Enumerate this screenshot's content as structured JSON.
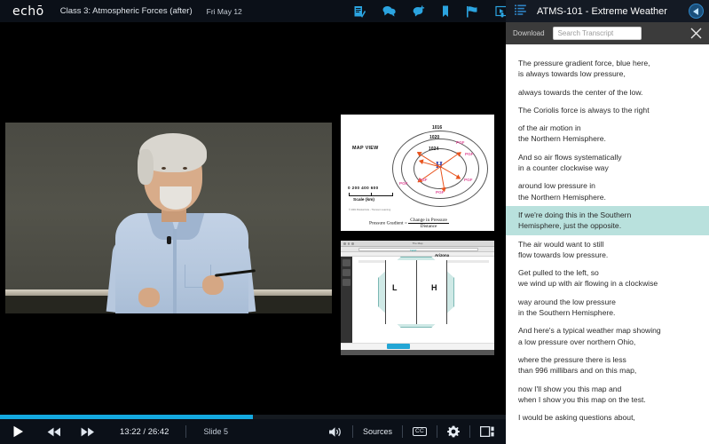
{
  "topbar": {
    "logo": "echō",
    "class_title": "Class 3: Atmospheric Forces (after)",
    "date": "Fri May 12",
    "icons": [
      {
        "name": "notes-icon"
      },
      {
        "name": "discussion-icon"
      },
      {
        "name": "add-comment-icon"
      },
      {
        "name": "bookmark-icon"
      },
      {
        "name": "flag-icon"
      },
      {
        "name": "slide-video-icon"
      }
    ]
  },
  "transcript": {
    "title": "ATMS-101 - Extreme Weather",
    "list_icon": "list-icon",
    "back_icon": "back-arrow-icon",
    "download_label": "Download",
    "search_placeholder": "Search Transcript",
    "search_value": "",
    "close_icon": "close-icon",
    "highlight_color": "#b9e1dd",
    "paragraphs": [
      {
        "text": "The pressure gradient force, blue here,\nis always towards low pressure,",
        "highlighted": false
      },
      {
        "text": "always towards the center of the low.",
        "highlighted": false
      },
      {
        "text": "The Coriolis force is always to the right",
        "highlighted": false
      },
      {
        "text": "of the air motion in\nthe Northern Hemisphere.",
        "highlighted": false
      },
      {
        "text": "And so air flows systematically\nin a counter clockwise way",
        "highlighted": false
      },
      {
        "text": "around low pressure in\nthe Northern Hemisphere.",
        "highlighted": false
      },
      {
        "text": "If we're doing this in the Southern\nHemisphere, just the opposite.",
        "highlighted": true
      },
      {
        "text": "The air would want to still\nflow towards low pressure.",
        "highlighted": false
      },
      {
        "text": "Get pulled to the left, so\nwe wind up with air flowing in a clockwise",
        "highlighted": false
      },
      {
        "text": "way around the low pressure\nin the Southern Hemisphere.",
        "highlighted": false
      },
      {
        "text": "And here's a typical weather map showing\na low pressure over northern Ohio,",
        "highlighted": false
      },
      {
        "text": "where the pressure there is less\nthan 996 millibars and on this map,",
        "highlighted": false
      },
      {
        "text": "now I'll show you this map and\nwhen I show you this map on the test.",
        "highlighted": false
      },
      {
        "text": "I would be asking questions about,",
        "highlighted": false
      }
    ]
  },
  "slides": {
    "slide1": {
      "map_view_label": "MAP VIEW",
      "isobars": [
        "1016",
        "1020",
        "1024"
      ],
      "center_letter": "H",
      "pgf_labels": [
        "PGF",
        "PGF",
        "PGF",
        "PGF",
        "PGF",
        "PGF"
      ],
      "scale_numbers": "0   200  400  600",
      "scale_label": "Scale (km)",
      "credit": "© 2001 Brooks/Cole - Thomson Learning",
      "formula_lhs": "Pressure Gradient  =",
      "formula_num": "Change in Pressure",
      "formula_den": "Distance"
    },
    "slide2": {
      "window_title": "The Map",
      "low_letter": "L",
      "high_letter": "H",
      "region_label": "Arizona",
      "top_small_label": "TEST"
    }
  },
  "controls": {
    "play_icon": "play-icon",
    "rewind_icon": "rewind-icon",
    "forward_icon": "fast-forward-icon",
    "current_time": "13:22",
    "total_time": "26:42",
    "time_display": "13:22 / 26:42",
    "slide_label": "Slide 5",
    "volume_icon": "volume-icon",
    "sources_label": "Sources",
    "cc_label": "CC",
    "settings_icon": "gear-icon",
    "layout_icon": "layout-icon",
    "progress_percent": 50,
    "progress_color": "#14a9e0"
  }
}
